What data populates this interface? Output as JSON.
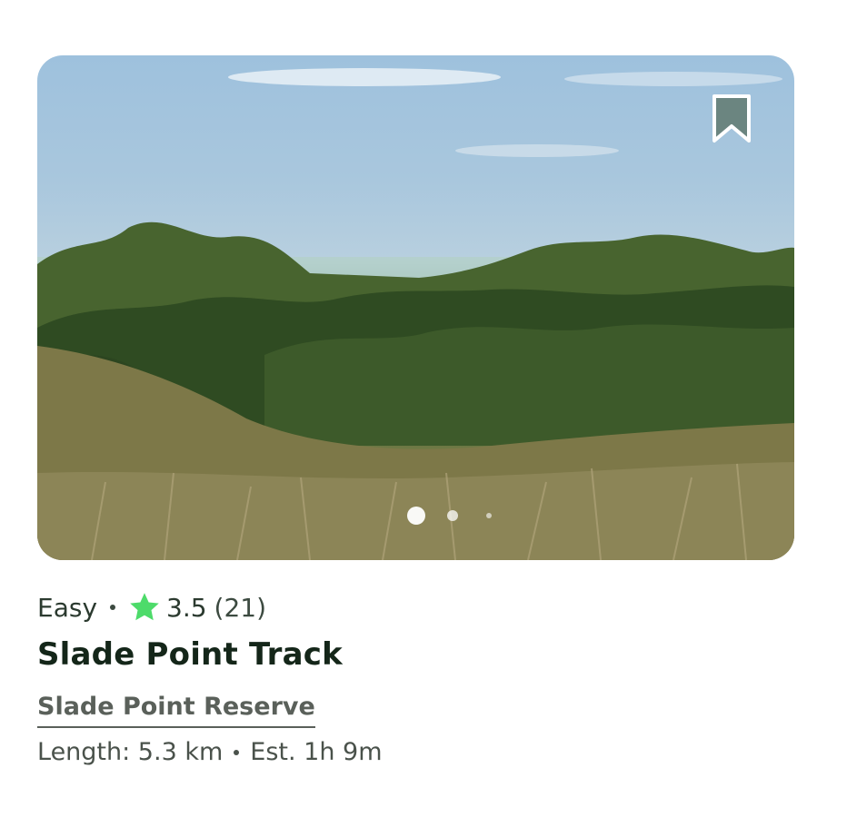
{
  "trail": {
    "difficulty": "Easy",
    "rating": "3.5",
    "review_count": "(21)",
    "name": "Slade Point Track",
    "park": "Slade Point Reserve",
    "length": "Length: 5.3 km",
    "est_time": "Est. 1h 9m"
  },
  "photo_carousel": {
    "dot_count": 3,
    "active_index": 0
  },
  "colors": {
    "star": "#4ddb6a",
    "bookmark": "#6b8580",
    "text_primary": "#142619",
    "text_secondary": "#4a524b"
  },
  "icons": {
    "bookmark": "bookmark-icon",
    "star": "star-icon"
  }
}
